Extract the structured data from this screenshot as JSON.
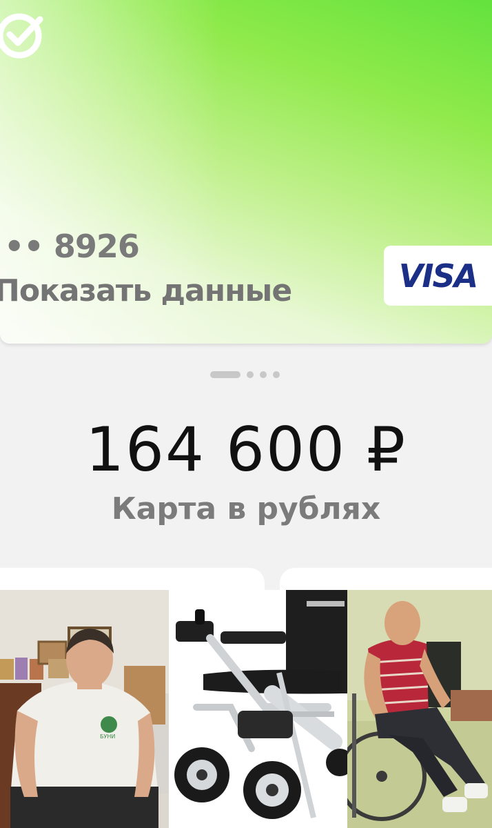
{
  "card": {
    "number_masked": "•• 8926",
    "show_details_label": "Показать данные",
    "payment_system": "VISA",
    "logo_icon": "sber-logo-icon",
    "gradient_colors": [
      "#63e23e",
      "#bff08a",
      "#f6fbef"
    ]
  },
  "pager": {
    "total": 4,
    "active": 1
  },
  "account": {
    "balance": "164 600 ₽",
    "label": "Карта в рублях"
  },
  "photos": [
    {
      "icon": "man-in-wheelchair-photo"
    },
    {
      "icon": "electric-wheelchair-photo"
    },
    {
      "icon": "elderly-man-in-wheelchair-photo"
    }
  ]
}
